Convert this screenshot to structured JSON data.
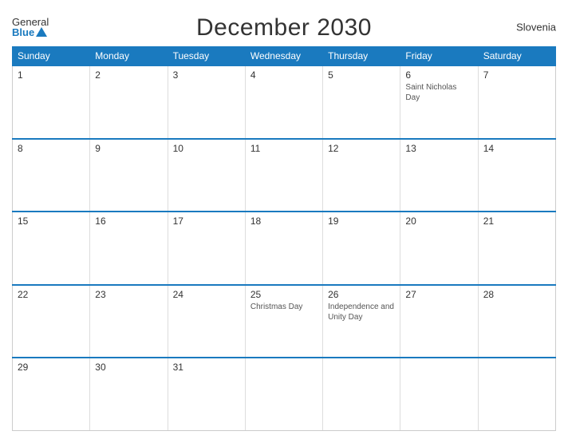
{
  "header": {
    "title": "December 2030",
    "country": "Slovenia",
    "logo_general": "General",
    "logo_blue": "Blue"
  },
  "weekdays": [
    "Sunday",
    "Monday",
    "Tuesday",
    "Wednesday",
    "Thursday",
    "Friday",
    "Saturday"
  ],
  "weeks": [
    [
      {
        "day": "1",
        "holiday": ""
      },
      {
        "day": "2",
        "holiday": ""
      },
      {
        "day": "3",
        "holiday": ""
      },
      {
        "day": "4",
        "holiday": ""
      },
      {
        "day": "5",
        "holiday": ""
      },
      {
        "day": "6",
        "holiday": "Saint Nicholas Day"
      },
      {
        "day": "7",
        "holiday": ""
      }
    ],
    [
      {
        "day": "8",
        "holiday": ""
      },
      {
        "day": "9",
        "holiday": ""
      },
      {
        "day": "10",
        "holiday": ""
      },
      {
        "day": "11",
        "holiday": ""
      },
      {
        "day": "12",
        "holiday": ""
      },
      {
        "day": "13",
        "holiday": ""
      },
      {
        "day": "14",
        "holiday": ""
      }
    ],
    [
      {
        "day": "15",
        "holiday": ""
      },
      {
        "day": "16",
        "holiday": ""
      },
      {
        "day": "17",
        "holiday": ""
      },
      {
        "day": "18",
        "holiday": ""
      },
      {
        "day": "19",
        "holiday": ""
      },
      {
        "day": "20",
        "holiday": ""
      },
      {
        "day": "21",
        "holiday": ""
      }
    ],
    [
      {
        "day": "22",
        "holiday": ""
      },
      {
        "day": "23",
        "holiday": ""
      },
      {
        "day": "24",
        "holiday": ""
      },
      {
        "day": "25",
        "holiday": "Christmas Day"
      },
      {
        "day": "26",
        "holiday": "Independence and Unity Day"
      },
      {
        "day": "27",
        "holiday": ""
      },
      {
        "day": "28",
        "holiday": ""
      }
    ],
    [
      {
        "day": "29",
        "holiday": ""
      },
      {
        "day": "30",
        "holiday": ""
      },
      {
        "day": "31",
        "holiday": ""
      },
      {
        "day": "",
        "holiday": ""
      },
      {
        "day": "",
        "holiday": ""
      },
      {
        "day": "",
        "holiday": ""
      },
      {
        "day": "",
        "holiday": ""
      }
    ]
  ]
}
